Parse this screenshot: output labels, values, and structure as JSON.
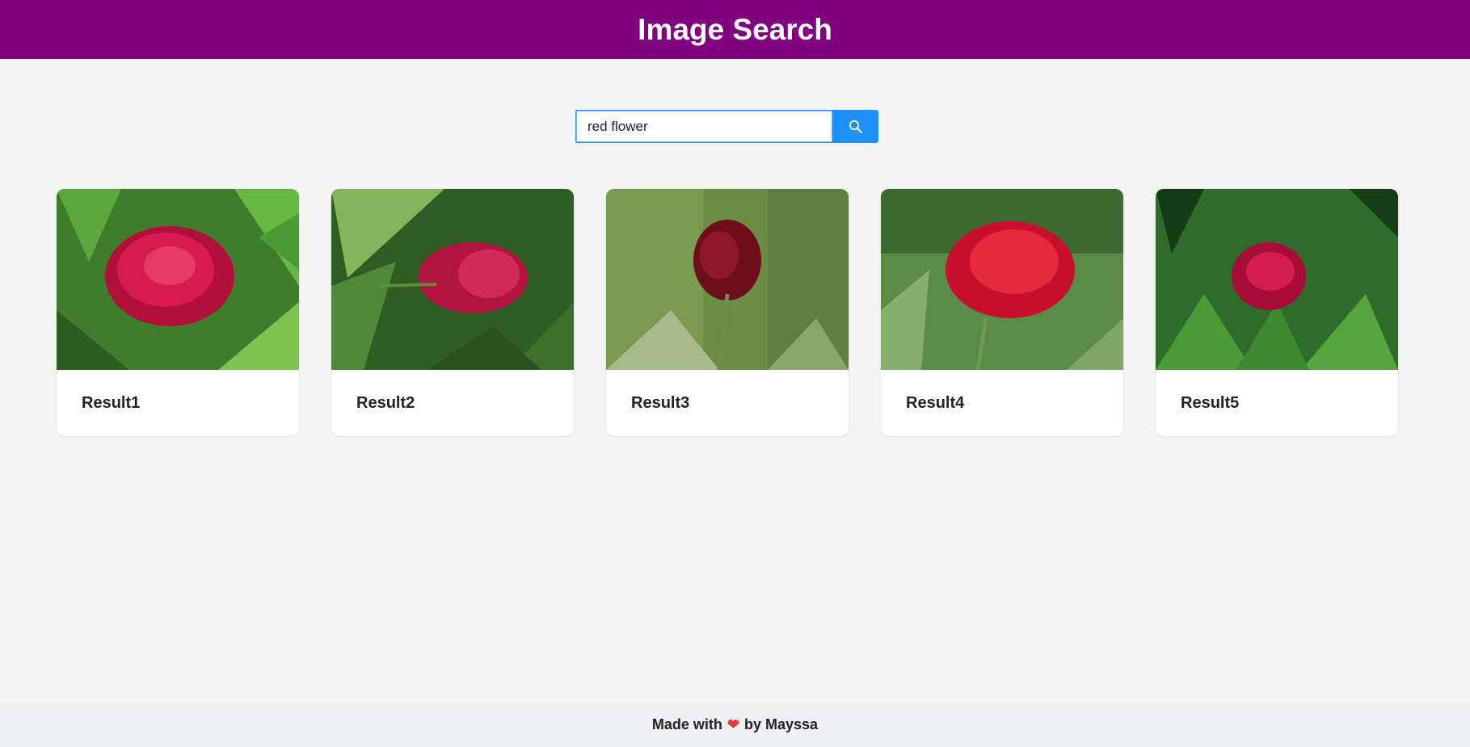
{
  "header": {
    "title": "Image Search"
  },
  "search": {
    "value": "red flower",
    "button_icon": "search-icon",
    "accent": "#1e90ff"
  },
  "results": [
    {
      "label": "Result1"
    },
    {
      "label": "Result2"
    },
    {
      "label": "Result3"
    },
    {
      "label": "Result4"
    },
    {
      "label": "Result5"
    }
  ],
  "footer": {
    "prefix": "Made with",
    "heart": "❤",
    "suffix": "by Mayssa"
  },
  "colors": {
    "header_bg": "#800080",
    "page_bg": "#f4f4f4",
    "button_bg": "#1e90ff"
  }
}
